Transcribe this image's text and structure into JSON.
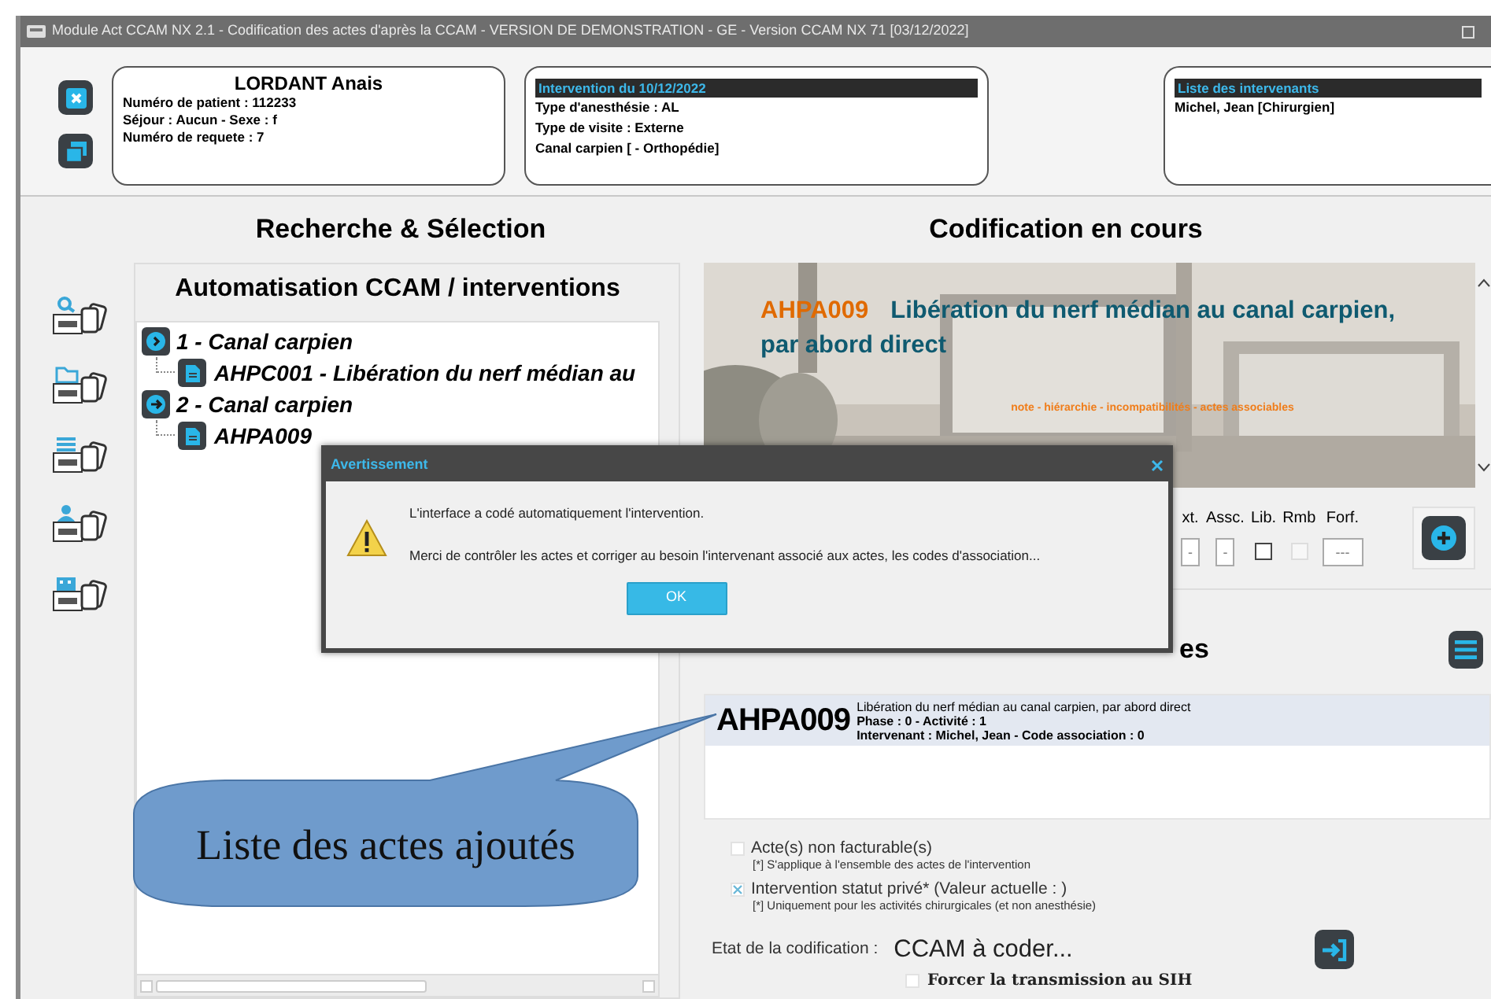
{
  "window": {
    "title": "Module Act CCAM NX 2.1 - Codification des actes d'après la CCAM - VERSION DE DEMONSTRATION - GE - Version CCAM NX 71 [03/12/2022]"
  },
  "patient": {
    "name": "LORDANT Anais",
    "lines": [
      "Numéro de patient : 112233",
      "Séjour : Aucun - Sexe : f",
      "Numéro de requete : 7"
    ]
  },
  "intervention": {
    "header": "Intervention du 10/12/2022",
    "lines": [
      "Type d'anesthésie : AL",
      "Type de visite : Externe",
      "Canal carpien [ - Orthopédie]"
    ]
  },
  "intervenants": {
    "header": "Liste des intervenants",
    "items": [
      "Michel, Jean [Chirurgien]"
    ]
  },
  "left": {
    "title": "Recherche & Sélection",
    "panel_title": "Automatisation CCAM / interventions",
    "tree": [
      {
        "label": "1 - Canal carpien",
        "kind": "chevron",
        "children": [
          {
            "label": "AHPC001 - Libération du nerf médian au"
          }
        ]
      },
      {
        "label": "2 - Canal carpien",
        "kind": "arrow",
        "children": [
          {
            "label": "AHPA009"
          }
        ]
      }
    ]
  },
  "right": {
    "title": "Codification en cours",
    "banner": {
      "code": "AHPA009",
      "title": "Libération du nerf médian au canal carpien, par abord direct",
      "links": "note - hiérarchie - incompatibilités - actes associables"
    },
    "fields": [
      {
        "label": "xt.",
        "kind": "input",
        "placeholder": "-"
      },
      {
        "label": "Assc.",
        "kind": "input",
        "placeholder": "-"
      },
      {
        "label": "Lib.",
        "kind": "checkbox",
        "checked": false,
        "disabled": false
      },
      {
        "label": "Rmb",
        "kind": "checkbox",
        "checked": false,
        "disabled": true
      },
      {
        "label": "Forf.",
        "kind": "input",
        "placeholder": "---"
      }
    ],
    "section_title": "es",
    "acts": [
      {
        "code": "AHPA009",
        "lines": [
          "Libération du nerf médian au canal carpien, par abord direct",
          "Phase : 0 - Activité : 1",
          "Intervenant : Michel, Jean - Code association : 0"
        ],
        "selected": true
      }
    ],
    "options": [
      {
        "label": "Acte(s) non facturable(s)",
        "note": "[*] S'applique à l'ensemble des actes de l'intervention",
        "checked": false
      },
      {
        "label": "Intervention statut privé* (Valeur actuelle :  )",
        "note": "[*] Uniquement pour les activités chirurgicales (et non anesthésie)",
        "checked": true
      }
    ],
    "status": {
      "label": "Etat de la codification :",
      "value": "CCAM à coder..."
    },
    "force": {
      "label": "Forcer la transmission au SIH",
      "checked": false
    }
  },
  "dialog": {
    "title": "Avertissement",
    "lines": [
      "L'interface a codé automatiquement l'intervention.",
      "Merci de contrôler les actes et corriger au besoin l'intervenant associé aux actes, les codes d'association..."
    ],
    "button": "OK"
  },
  "callout": {
    "text": "Liste des actes ajoutés"
  }
}
